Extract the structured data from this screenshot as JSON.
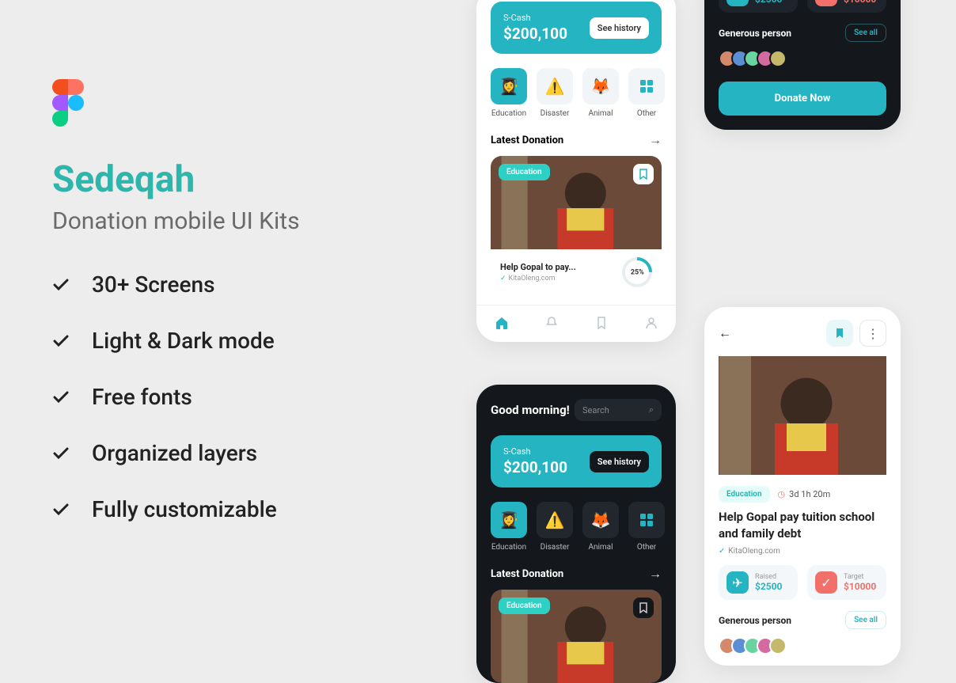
{
  "marketing": {
    "title": "Sedeqah",
    "subtitle": "Donation mobile UI Kits",
    "features": [
      "30+ Screens",
      "Light & Dark mode",
      "Free fonts",
      "Organized layers",
      "Fully customizable"
    ]
  },
  "home": {
    "scash_label": "S-Cash",
    "scash_amount": "$200,100",
    "history_btn": "See history",
    "categories": [
      {
        "emoji": "👩‍🎓",
        "name": "Education",
        "active": true
      },
      {
        "emoji": "⚠️",
        "name": "Disaster",
        "active": false
      },
      {
        "emoji": "🦊",
        "name": "Animal",
        "active": false
      },
      {
        "emoji": "🟦",
        "name": "Other",
        "active": false,
        "grid": true
      }
    ],
    "latest_label": "Latest Donation",
    "card": {
      "tag": "Education",
      "title": "Help Gopal to pay...",
      "source": "KitaOleng.com",
      "progress": "25%"
    },
    "greeting": "Good morning!",
    "search_placeholder": "Search"
  },
  "detail": {
    "tag": "Education",
    "time": "3d 1h 20m",
    "title": "Help Gopal pay tuition school and family debt",
    "source": "KitaOleng.com",
    "raised_label": "Raised",
    "raised_value": "$2500",
    "target_label": "Target",
    "target_value": "$10000",
    "generous_label": "Generous person",
    "see_all": "See all",
    "donate_btn": "Donate Now",
    "avatar_colors": [
      "#d48a6a",
      "#5a8fd4",
      "#6ad4a1",
      "#d46a9f",
      "#c4b86a"
    ]
  }
}
